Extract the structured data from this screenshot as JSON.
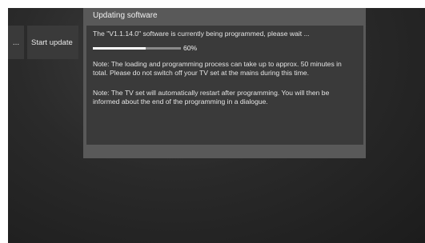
{
  "menu": {
    "stub_label": "...",
    "start_update_label": "Start update"
  },
  "dialog": {
    "title": "Updating software",
    "status_text": "The \"V1.1.14.0\" software is currently being programmed, please wait ...",
    "progress": {
      "percent": 60,
      "label": "60%"
    },
    "note_1": "Note: The loading and programming process can take up to approx. 50 minutes in total. Please do not switch off your TV set at the mains during this time.",
    "note_2": "Note: The TV set will automatically restart after programming. You will then be informed about the end of the programming in a dialogue."
  }
}
